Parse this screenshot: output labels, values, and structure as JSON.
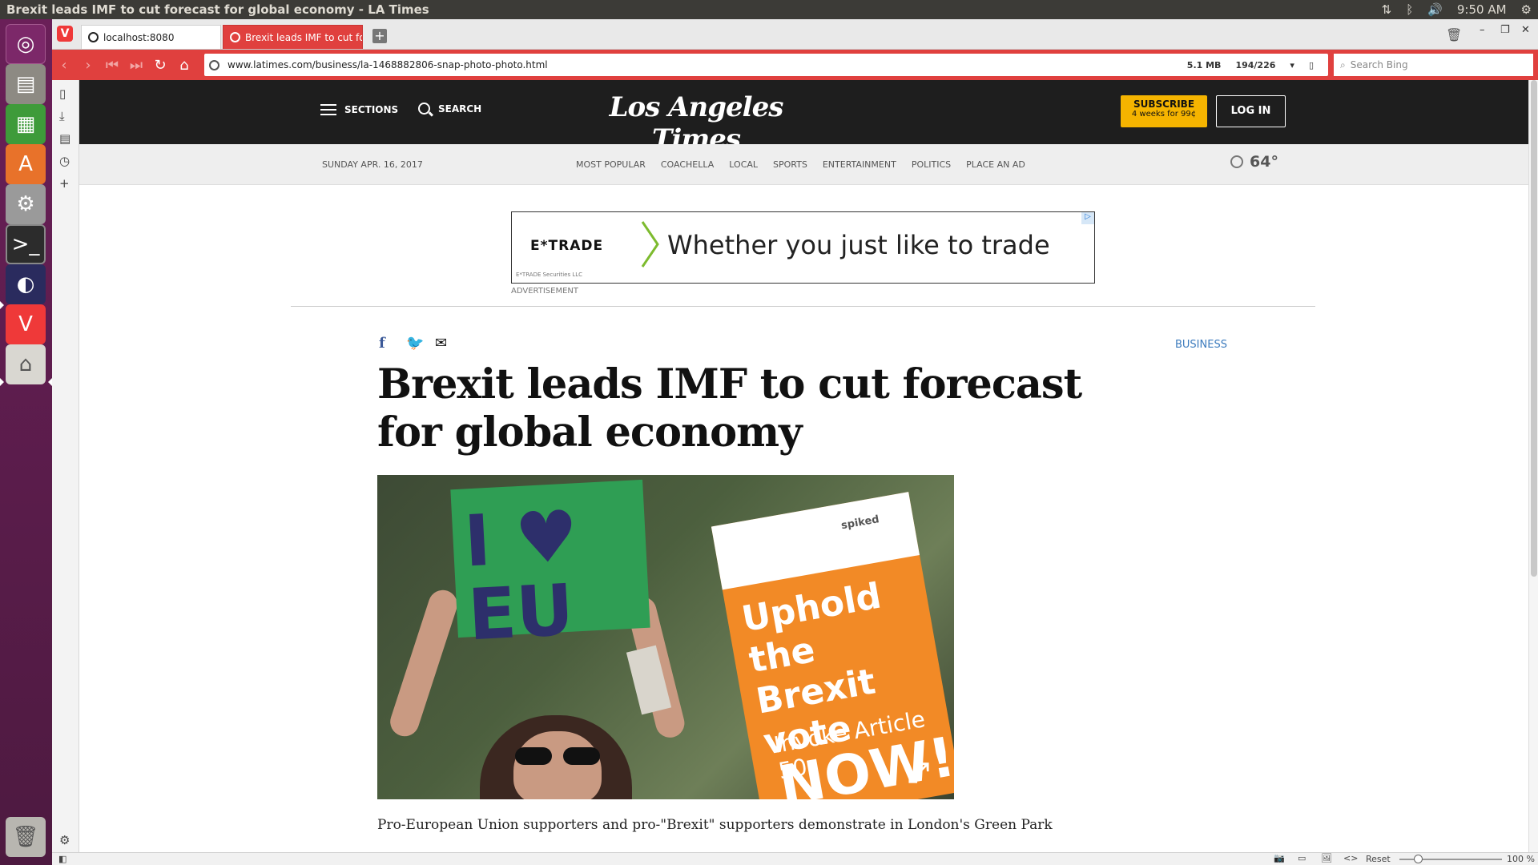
{
  "panel": {
    "window_title": "Brexit leads IMF to cut forecast for global economy - LA Times",
    "clock": "9:50 AM"
  },
  "launcher": {
    "items": [
      "ubuntu-dash",
      "file-manager",
      "spreadsheet",
      "software-center",
      "system-settings",
      "terminal",
      "eclipse",
      "vivaldi",
      "disks",
      "trash"
    ]
  },
  "browser": {
    "tabs": [
      {
        "label": "localhost:8080"
      },
      {
        "label": "Brexit leads IMF to cut forecast for global economy"
      }
    ],
    "url": "www.latimes.com/business/la-1468882806-snap-photo-photo.html",
    "memory": "5.1 MB",
    "counter": "194/226",
    "search_placeholder": "Search Bing",
    "status": {
      "reset": "Reset",
      "zoom": "100 %"
    },
    "colors": {
      "accent": "#e0403e"
    }
  },
  "site": {
    "header": {
      "sections": "SECTIONS",
      "search": "SEARCH",
      "logo": "Los Angeles Times",
      "subscribe": "SUBSCRIBE",
      "subscribe_offer": "4 weeks for 99¢",
      "login": "LOG IN"
    },
    "subnav": {
      "date": "SUNDAY APR. 16, 2017",
      "links": [
        "MOST POPULAR",
        "COACHELLA",
        "LOCAL",
        "SPORTS",
        "ENTERTAINMENT",
        "POLITICS",
        "PLACE AN AD"
      ],
      "temperature": "64°"
    },
    "ad": {
      "brand": "E*TRADE",
      "text": "Whether you just like to trade",
      "fineprint": "E*TRADE Securities LLC",
      "label": "ADVERTISEMENT"
    },
    "article": {
      "category": "BUSINESS",
      "headline": "Brexit leads IMF to cut forecast for global economy",
      "photo": {
        "sign_left": "I ♥ EU",
        "sign_right_brand": "spiked",
        "sign_right_main": "Uphold the Brexit vote",
        "sign_right_sub": "Invoke Article 50",
        "sign_right_big": "NOW!"
      },
      "caption": "Pro-European Union supporters and pro-\"Brexit\" supporters demonstrate in London's Green Park"
    }
  }
}
